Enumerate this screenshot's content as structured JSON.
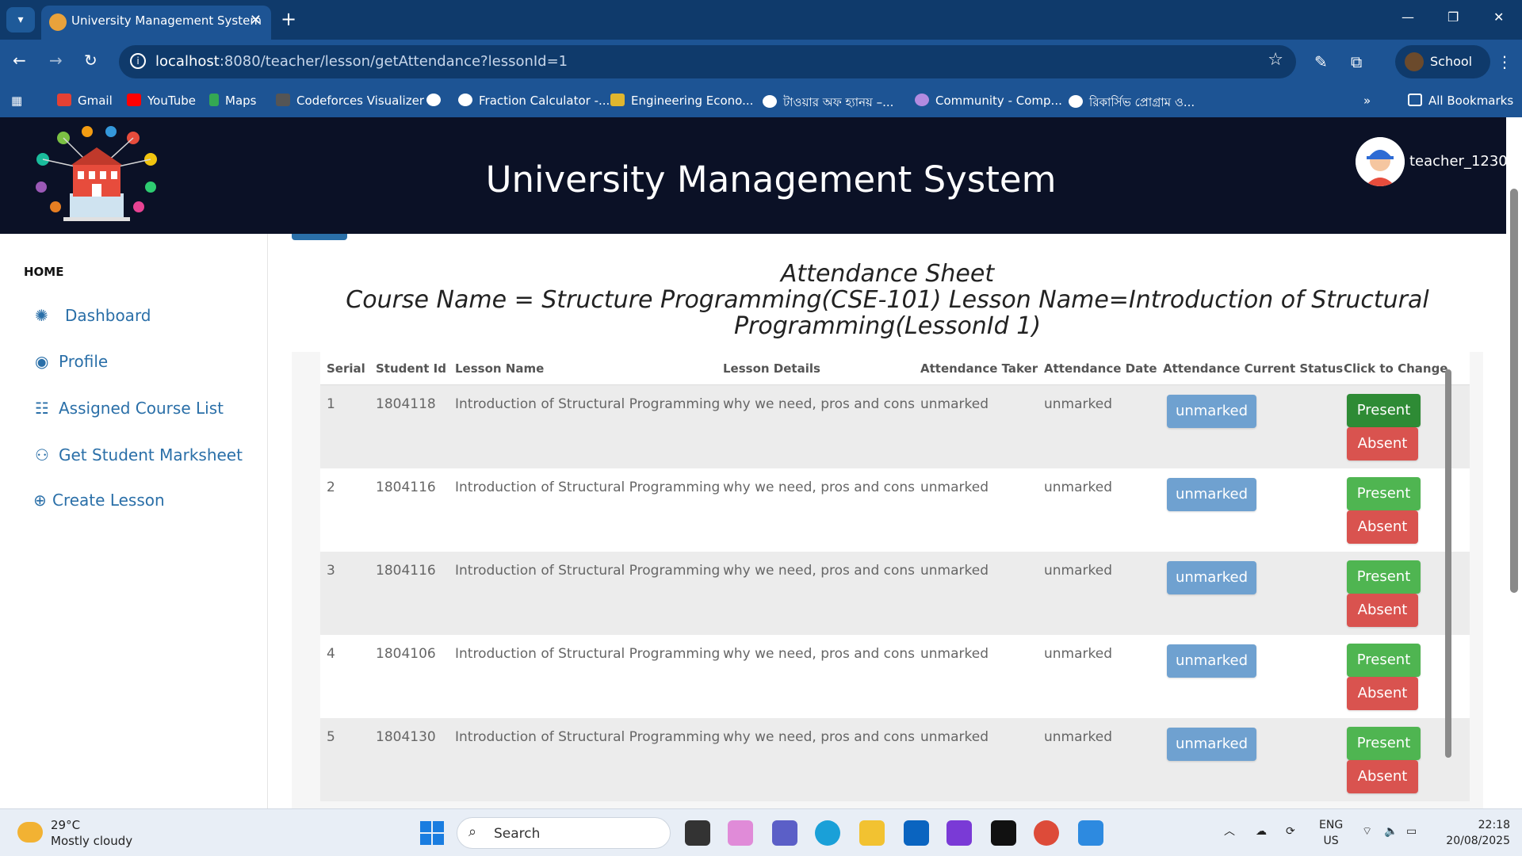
{
  "browser": {
    "tab_title": "University Management System",
    "url_host": "localhost",
    "url_path": ":8080/teacher/lesson/getAttendance?lessonId=1",
    "profile_label": "School",
    "bookmarks": [
      "Gmail",
      "YouTube",
      "Maps",
      "Codeforces Visualizer",
      "Fraction Calculator -...",
      "Engineering Econo...",
      "টাওয়ার অফ হ্যানয় –...",
      "Community - Comp...",
      "রিকার্সিভ প্রোগ্রাম ও..."
    ],
    "all_bookmarks": "All Bookmarks"
  },
  "header": {
    "title": "University Management System",
    "username": "teacher_1230"
  },
  "sidebar": {
    "home": "HOME",
    "items": [
      {
        "label": "Dashboard",
        "icon": "dashboard-icon"
      },
      {
        "label": "Profile",
        "icon": "profile-icon"
      },
      {
        "label": "Assigned Course List",
        "icon": "list-icon"
      },
      {
        "label": "Get Student Marksheet",
        "icon": "user-icon"
      },
      {
        "label": "Create Lesson",
        "icon": "plus-circle-icon"
      }
    ]
  },
  "sheet": {
    "title": "Attendance Sheet",
    "subtitle_1": "Course Name = Structure Programming(CSE-101) Lesson Name=Introduction of Structural",
    "subtitle_2": "Programming(LessonId 1)"
  },
  "table": {
    "headers": [
      "Serial",
      "Student Id",
      "Lesson Name",
      "Lesson Details",
      "Attendance Taker",
      "Attendance Date",
      "Attendance Current Status",
      "Click to Change"
    ],
    "rows": [
      {
        "serial": "1",
        "student_id": "1804118",
        "lesson_name": "Introduction of Structural Programming",
        "lesson_details": "why we need, pros and cons",
        "taker": "unmarked",
        "date": "unmarked",
        "status": "unmarked",
        "present": "Present",
        "absent": "Absent"
      },
      {
        "serial": "2",
        "student_id": "1804116",
        "lesson_name": "Introduction of Structural Programming",
        "lesson_details": "why we need, pros and cons",
        "taker": "unmarked",
        "date": "unmarked",
        "status": "unmarked",
        "present": "Present",
        "absent": "Absent"
      },
      {
        "serial": "3",
        "student_id": "1804116",
        "lesson_name": "Introduction of Structural Programming",
        "lesson_details": "why we need, pros and cons",
        "taker": "unmarked",
        "date": "unmarked",
        "status": "unmarked",
        "present": "Present",
        "absent": "Absent"
      },
      {
        "serial": "4",
        "student_id": "1804106",
        "lesson_name": "Introduction of Structural Programming",
        "lesson_details": "why we need, pros and cons",
        "taker": "unmarked",
        "date": "unmarked",
        "status": "unmarked",
        "present": "Present",
        "absent": "Absent"
      },
      {
        "serial": "5",
        "student_id": "1804130",
        "lesson_name": "Introduction of Structural Programming",
        "lesson_details": "why we need, pros and cons",
        "taker": "unmarked",
        "date": "unmarked",
        "status": "unmarked",
        "present": "Present",
        "absent": "Absent"
      }
    ]
  },
  "taskbar": {
    "temp": "29°C",
    "weather": "Mostly cloudy",
    "search": "Search",
    "lang_1": "ENG",
    "lang_2": "US",
    "time": "22:18",
    "date": "20/08/2025"
  },
  "colors": {
    "header_bg": "#0b1126",
    "link": "#2a6fa8",
    "status_btn": "#6fa1d0",
    "present_btn": "#4fb551",
    "absent_btn": "#d9534f"
  }
}
